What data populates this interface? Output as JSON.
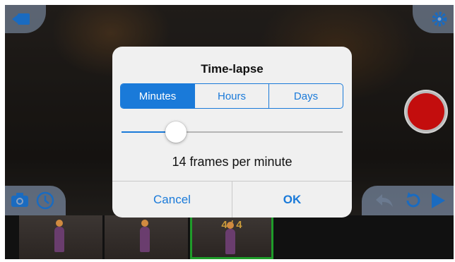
{
  "dialog": {
    "title": "Time-lapse",
    "segments": [
      {
        "label": "Minutes",
        "active": true
      },
      {
        "label": "Hours",
        "active": false
      },
      {
        "label": "Days",
        "active": false
      }
    ],
    "slider_value": 0.245,
    "frames_label": "14 frames per minute",
    "cancel_label": "Cancel",
    "ok_label": "OK"
  },
  "filmstrip": {
    "counter": "4 / 4"
  },
  "colors": {
    "accent": "#1a7ad9",
    "record": "#c30d0d",
    "selected_frame": "#1f9c2a",
    "toolbar": "#8ca0be"
  },
  "icons": {
    "top_left": "switch-camera-icon",
    "top_right": "gear-icon",
    "bottom_left": [
      "camera-icon",
      "clock-icon"
    ],
    "bottom_right": [
      "undo-icon",
      "replay-icon",
      "play-icon"
    ]
  }
}
